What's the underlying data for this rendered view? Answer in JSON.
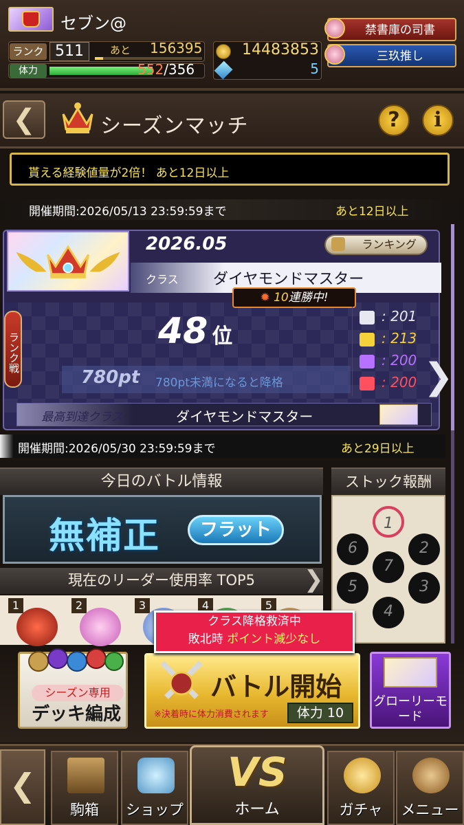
{
  "player": {
    "name": "セブン@",
    "rank_label": "ランク",
    "rank": "511",
    "next_label": "あと",
    "next_exp": "156395",
    "exp_progress": 0.08,
    "hp_label": "体力",
    "hp_current": "552",
    "hp_max": "/356",
    "coins": "14483853",
    "gems": "5"
  },
  "top_buttons": {
    "title1": "禁書庫の司書",
    "title2": "三玖推し"
  },
  "header": {
    "title": "シーズンマッチ",
    "help": "?",
    "info": "i"
  },
  "notice": "貰える経験値量が2倍！ あと12日以上",
  "period1": {
    "text": "開催期間:2026/05/13 23:59:59まで",
    "remain": "あと12日以上"
  },
  "rank_panel": {
    "season": "2026.05",
    "ranking_button": "ランキング",
    "class_label": "クラス",
    "class_value": "ダイヤモンドマスター",
    "streak": "10",
    "streak_suffix": "連勝中!",
    "tab_label": "ランク戦",
    "position": "48",
    "position_suffix": "位",
    "points": "780pt",
    "points_note": "780pt未満になると降格",
    "stats": [
      {
        "icon": "bars-icon",
        "value": "201",
        "color": "#e8e8f0"
      },
      {
        "icon": "gold-crown-icon",
        "value": "213",
        "color": "#f5d23a"
      },
      {
        "icon": "purple-crown-icon",
        "value": "200",
        "color": "#b870ff"
      },
      {
        "icon": "red-beast-icon",
        "value": "200",
        "color": "#ff5060"
      }
    ],
    "best_label": "最高到達クラス",
    "best_value": "ダイヤモンドマスター"
  },
  "period2": {
    "text": "開催期間:2026/05/30 23:59:59まで",
    "remain": "あと29日以上"
  },
  "battle_info": {
    "title": "今日のバトル情報",
    "banner_main": "無補正",
    "banner_sub": "フラット",
    "top5_title": "現在のリーダー使用率 TOP5",
    "ranks": [
      "1",
      "2",
      "3",
      "4",
      "5"
    ]
  },
  "stock": {
    "title": "ストック報酬",
    "nodes": [
      "1",
      "2",
      "3",
      "4",
      "5",
      "6",
      "7"
    ]
  },
  "promo_tag": {
    "line1": "クラス降格救済中",
    "line2a": "敗北時",
    "line2b": "ポイント減少なし"
  },
  "deck_button": {
    "label1": "シーズン専用",
    "label2": "デッキ編成"
  },
  "battle_button": {
    "label": "バトル開始",
    "note": "※決着時に体力消費されます",
    "hp_cost": "体力 10"
  },
  "glory_button": {
    "label": "グローリーモード"
  },
  "nav": {
    "items": [
      "駒箱",
      "ショップ",
      "ホーム",
      "ガチャ",
      "メニュー"
    ],
    "home_vs": "VS"
  },
  "colors": {
    "accent_gold": "#d7b64a",
    "panel_purple": "#2b2550",
    "notice_yellow": "#f7e25a"
  }
}
